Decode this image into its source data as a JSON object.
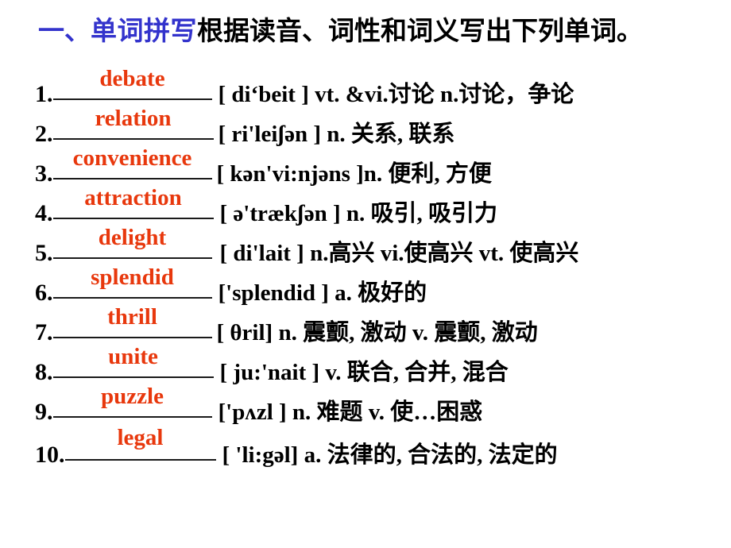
{
  "slide": {
    "heading": {
      "section_marker": "一、",
      "highlight": "单词拼写",
      "instruction": "根据读音、词性和词义写出下列单词。"
    },
    "colors": {
      "heading_accent": "#3333cc",
      "answer_word": "#e8380d",
      "body_text": "#000000",
      "background": "#ffffff"
    },
    "items": [
      {
        "number": "1.",
        "answer": "debate",
        "tail": "[ di‘beit ] vt. &vi.讨论 n.讨论，争论",
        "blank_width": 200,
        "gap": 8
      },
      {
        "number": "2.",
        "answer": "relation",
        "tail": "[ ri'leiʃən ]   n. 关系, 联系",
        "blank_width": 202,
        "gap": 6
      },
      {
        "number": "3.",
        "answer": "convenience",
        "tail": "[ kən'vi:njəns ]n. 便利, 方便",
        "blank_width": 200,
        "gap": 6
      },
      {
        "number": "4.",
        "answer": "attraction",
        "tail": "[ ə'trækʃən ]  n. 吸引, 吸引力",
        "blank_width": 202,
        "gap": 8
      },
      {
        "number": "5.",
        "answer": "delight",
        "tail": "[ di'lait ] n.高兴 vi.使高兴 vt. 使高兴",
        "blank_width": 200,
        "gap": 10
      },
      {
        "number": "6.",
        "answer": "splendid",
        "tail": "['splendid ] a. 极好的",
        "blank_width": 200,
        "gap": 8
      },
      {
        "number": "7.",
        "answer": "thrill",
        "tail": "[ θril] n. 震颤, 激动 v. 震颤, 激动",
        "blank_width": 200,
        "gap": 6
      },
      {
        "number": "8.",
        "answer": "unite",
        "tail": "[ ju:'nait ] v. 联合, 合并, 混合",
        "blank_width": 202,
        "gap": 8
      },
      {
        "number": "9.",
        "answer": "puzzle",
        "tail": "['pʌzl ] n. 难题 v. 使…困惑",
        "blank_width": 200,
        "gap": 8
      },
      {
        "number": "10.",
        "answer": "legal",
        "tail": "[ 'li:gəl] a. 法律的, 合法的, 法定的",
        "blank_width": 190,
        "gap": 8
      }
    ]
  }
}
